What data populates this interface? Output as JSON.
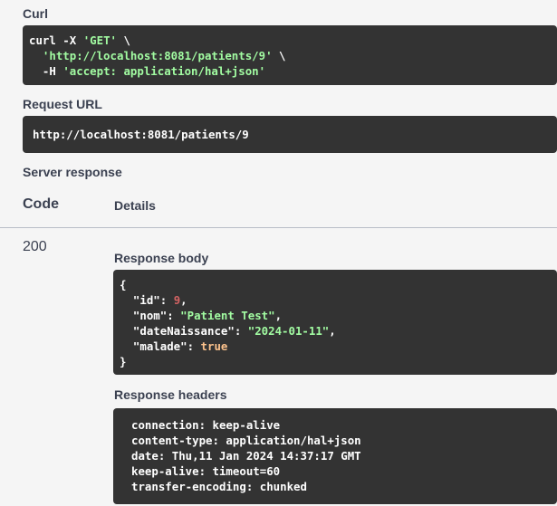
{
  "curl": {
    "label": "Curl",
    "line1_cmd": "curl -X ",
    "line1_method": "'GET'",
    "line1_cont": " \\",
    "line2_url": "'http://localhost:8081/patients/9'",
    "line2_cont": " \\",
    "line3_flag": "-H ",
    "line3_header": "'accept: application/hal+json'"
  },
  "request_url": {
    "label": "Request URL",
    "value": "http://localhost:8081/patients/9"
  },
  "server_response": {
    "label": "Server response",
    "col_code": "Code",
    "col_details": "Details",
    "status_code": "200"
  },
  "response_body": {
    "label": "Response body",
    "open_brace": "{",
    "close_brace": "}",
    "fields": [
      {
        "key": "\"id\"",
        "value": "9",
        "type": "number",
        "comma": ","
      },
      {
        "key": "\"nom\"",
        "value": "\"Patient Test\"",
        "type": "string",
        "comma": ","
      },
      {
        "key": "\"dateNaissance\"",
        "value": "\"2024-01-11\"",
        "type": "string",
        "comma": ","
      },
      {
        "key": "\"malade\"",
        "value": "true",
        "type": "boolean",
        "comma": ""
      }
    ]
  },
  "response_headers": {
    "label": "Response headers",
    "lines": [
      "connection: keep-alive",
      "content-type: application/hal+json",
      "date: Thu,11 Jan 2024 14:37:17 GMT",
      "keep-alive: timeout=60",
      "transfer-encoding: chunked"
    ]
  },
  "colors": {
    "string": "#a2fca2",
    "number": "#d36363",
    "boolean": "#fcc28c",
    "code_bg": "#333333",
    "page_bg": "#f5f5f5"
  }
}
